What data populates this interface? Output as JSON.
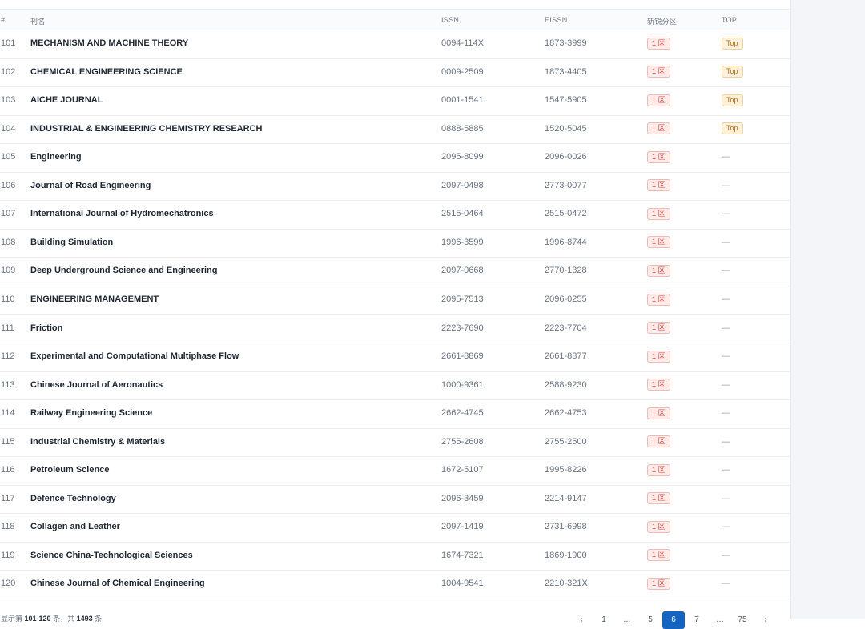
{
  "table": {
    "headers": {
      "idx": "#",
      "name": "刊名",
      "issn": "ISSN",
      "eissn": "EISSN",
      "zone": "新锐分区",
      "top": "TOP"
    },
    "rows": [
      {
        "idx": "101",
        "name": "MECHANISM AND MACHINE THEORY",
        "issn": "0094-114X",
        "eissn": "1873-3999",
        "zone": "1 区",
        "top": "Top"
      },
      {
        "idx": "102",
        "name": "CHEMICAL ENGINEERING SCIENCE",
        "issn": "0009-2509",
        "eissn": "1873-4405",
        "zone": "1 区",
        "top": "Top"
      },
      {
        "idx": "103",
        "name": "AICHE JOURNAL",
        "issn": "0001-1541",
        "eissn": "1547-5905",
        "zone": "1 区",
        "top": "Top"
      },
      {
        "idx": "104",
        "name": "INDUSTRIAL & ENGINEERING CHEMISTRY RESEARCH",
        "issn": "0888-5885",
        "eissn": "1520-5045",
        "zone": "1 区",
        "top": "Top"
      },
      {
        "idx": "105",
        "name": "Engineering",
        "issn": "2095-8099",
        "eissn": "2096-0026",
        "zone": "1 区",
        "top": "—"
      },
      {
        "idx": "106",
        "name": "Journal of Road Engineering",
        "issn": "2097-0498",
        "eissn": "2773-0077",
        "zone": "1 区",
        "top": "—"
      },
      {
        "idx": "107",
        "name": "International Journal of Hydromechatronics",
        "issn": "2515-0464",
        "eissn": "2515-0472",
        "zone": "1 区",
        "top": "—"
      },
      {
        "idx": "108",
        "name": "Building Simulation",
        "issn": "1996-3599",
        "eissn": "1996-8744",
        "zone": "1 区",
        "top": "—"
      },
      {
        "idx": "109",
        "name": "Deep Underground Science and Engineering",
        "issn": "2097-0668",
        "eissn": "2770-1328",
        "zone": "1 区",
        "top": "—"
      },
      {
        "idx": "110",
        "name": "ENGINEERING MANAGEMENT",
        "issn": "2095-7513",
        "eissn": "2096-0255",
        "zone": "1 区",
        "top": "—"
      },
      {
        "idx": "111",
        "name": "Friction",
        "issn": "2223-7690",
        "eissn": "2223-7704",
        "zone": "1 区",
        "top": "—"
      },
      {
        "idx": "112",
        "name": "Experimental and Computational Multiphase Flow",
        "issn": "2661-8869",
        "eissn": "2661-8877",
        "zone": "1 区",
        "top": "—"
      },
      {
        "idx": "113",
        "name": "Chinese Journal of Aeronautics",
        "issn": "1000-9361",
        "eissn": "2588-9230",
        "zone": "1 区",
        "top": "—"
      },
      {
        "idx": "114",
        "name": "Railway Engineering Science",
        "issn": "2662-4745",
        "eissn": "2662-4753",
        "zone": "1 区",
        "top": "—"
      },
      {
        "idx": "115",
        "name": "Industrial Chemistry & Materials",
        "issn": "2755-2608",
        "eissn": "2755-2500",
        "zone": "1 区",
        "top": "—"
      },
      {
        "idx": "116",
        "name": "Petroleum Science",
        "issn": "1672-5107",
        "eissn": "1995-8226",
        "zone": "1 区",
        "top": "—"
      },
      {
        "idx": "117",
        "name": "Defence Technology",
        "issn": "2096-3459",
        "eissn": "2214-9147",
        "zone": "1 区",
        "top": "—"
      },
      {
        "idx": "118",
        "name": "Collagen and Leather",
        "issn": "2097-1419",
        "eissn": "2731-6998",
        "zone": "1 区",
        "top": "—"
      },
      {
        "idx": "119",
        "name": "Science China-Technological Sciences",
        "issn": "1674-7321",
        "eissn": "1869-1900",
        "zone": "1 区",
        "top": "—"
      },
      {
        "idx": "120",
        "name": "Chinese Journal of Chemical Engineering",
        "issn": "1004-9541",
        "eissn": "2210-321X",
        "zone": "1 区",
        "top": "—"
      }
    ]
  },
  "footer": {
    "prefix": "显示第",
    "range": "101-120",
    "mid": "条，共",
    "total": "1493",
    "suffix": "条"
  },
  "pagination": {
    "prev": "‹",
    "next": "›",
    "pages": [
      "1",
      "…",
      "5",
      "6",
      "7",
      "…",
      "75"
    ],
    "current": "6"
  },
  "colors": {
    "accent": "#1565c0",
    "zone_badge": "#d9534f",
    "top_badge": "#b86e12"
  }
}
